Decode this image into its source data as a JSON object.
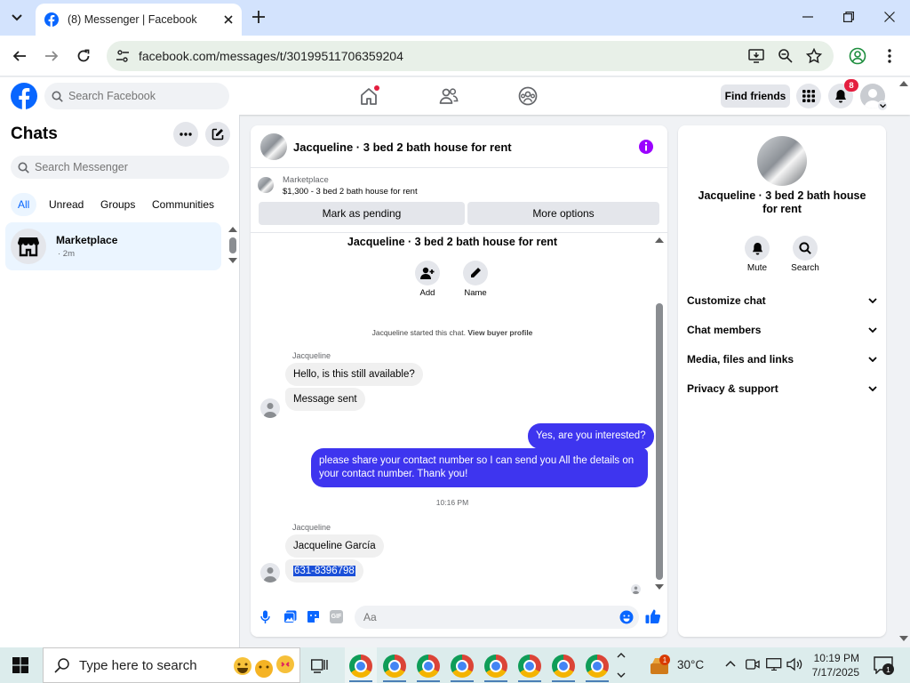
{
  "browser": {
    "tab_title": "(8) Messenger | Facebook",
    "url": "facebook.com/messages/t/30199511706359204"
  },
  "header": {
    "search_placeholder": "Search Facebook",
    "find_friends": "Find friends",
    "notification_count": "8"
  },
  "sidebar": {
    "title": "Chats",
    "search_placeholder": "Search Messenger",
    "filters": [
      "All",
      "Unread",
      "Groups",
      "Communities"
    ],
    "active_filter": "All",
    "chats": [
      {
        "name": "Marketplace",
        "preview": "· 2m"
      }
    ]
  },
  "conversation": {
    "title": "Jacqueline · 3 bed 2 bath house for rent",
    "listing_label": "Marketplace",
    "listing_detail": "$1,300 - 3 bed 2 bath house for rent",
    "mark_pending": "Mark as pending",
    "more_options": "More options",
    "intro_title": "Jacqueline · 3 bed 2 bath house for rent",
    "add_label": "Add",
    "name_label": "Name",
    "started_text": "Jacqueline started this chat.",
    "buyer_profile": "View buyer profile",
    "messages": [
      {
        "sender": "Jacqueline",
        "text": "Hello, is this still available?"
      },
      {
        "text": "Message sent"
      },
      {
        "text": "Yes, are you interested?"
      },
      {
        "text": "please share your contact number so I can send you All the details on your contact number. Thank you!"
      },
      {
        "sender": "Jacqueline",
        "text": "Jacqueline García"
      },
      {
        "text": "631-8396798"
      }
    ],
    "timestamp": "10:16 PM",
    "composer_placeholder": "Aa"
  },
  "info_panel": {
    "title": "Jacqueline · 3 bed 2 bath house for rent",
    "mute": "Mute",
    "search": "Search",
    "sections": [
      "Customize chat",
      "Chat members",
      "Media, files and links",
      "Privacy & support"
    ]
  },
  "taskbar": {
    "search_placeholder": "Type here to search",
    "weather": "30°C",
    "weather_badge": "1",
    "time": "10:19 PM",
    "date": "7/17/2025",
    "notification_count": "1"
  },
  "colors": {
    "facebook_blue": "#0866ff",
    "outgoing_bubble": "#3e35ef",
    "badge_red": "#e41e3f",
    "info_purple": "#9b00ff"
  }
}
